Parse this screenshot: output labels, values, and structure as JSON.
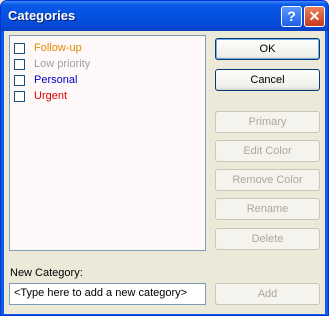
{
  "window": {
    "title": "Categories"
  },
  "title_buttons": {
    "help": "?",
    "close": "✕"
  },
  "categories": [
    {
      "label": "Follow-up",
      "color": "#e08c00",
      "checked": false
    },
    {
      "label": "Low priority",
      "color": "#a0a0a0",
      "checked": false
    },
    {
      "label": "Personal",
      "color": "#0000c0",
      "checked": false
    },
    {
      "label": "Urgent",
      "color": "#e00000",
      "checked": false
    }
  ],
  "buttons": {
    "ok": "OK",
    "cancel": "Cancel",
    "primary": "Primary",
    "edit_color": "Edit Color",
    "remove_color": "Remove Color",
    "rename": "Rename",
    "delete": "Delete",
    "add": "Add"
  },
  "new_category": {
    "label": "New Category:",
    "value": "<Type here to add a new category>"
  }
}
